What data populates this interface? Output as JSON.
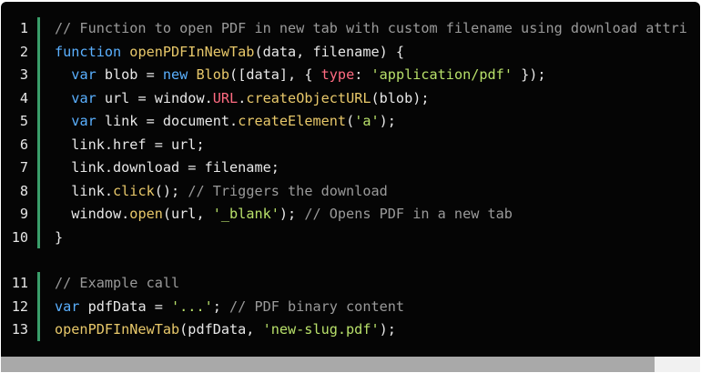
{
  "code_block_1": {
    "lines": [
      {
        "num": "1",
        "tokens": [
          {
            "t": "comment",
            "v": "// Function to open PDF in new tab with custom filename using download attri"
          }
        ]
      },
      {
        "num": "2",
        "tokens": [
          {
            "t": "kw",
            "v": "function "
          },
          {
            "t": "fn",
            "v": "openPDFInNewTab"
          },
          {
            "t": "plain",
            "v": "(data, filename) {"
          }
        ]
      },
      {
        "num": "3",
        "tokens": [
          {
            "t": "plain",
            "v": "  "
          },
          {
            "t": "kw",
            "v": "var "
          },
          {
            "t": "plain",
            "v": "blob = "
          },
          {
            "t": "kw",
            "v": "new "
          },
          {
            "t": "fn",
            "v": "Blob"
          },
          {
            "t": "plain",
            "v": "([data], { "
          },
          {
            "t": "prop",
            "v": "type"
          },
          {
            "t": "plain",
            "v": ": "
          },
          {
            "t": "str",
            "v": "'application/pdf'"
          },
          {
            "t": "plain",
            "v": " });"
          }
        ]
      },
      {
        "num": "4",
        "tokens": [
          {
            "t": "plain",
            "v": "  "
          },
          {
            "t": "kw",
            "v": "var "
          },
          {
            "t": "plain",
            "v": "url = window."
          },
          {
            "t": "prop",
            "v": "URL"
          },
          {
            "t": "plain",
            "v": "."
          },
          {
            "t": "fn",
            "v": "createObjectURL"
          },
          {
            "t": "plain",
            "v": "(blob);"
          }
        ]
      },
      {
        "num": "5",
        "tokens": [
          {
            "t": "plain",
            "v": "  "
          },
          {
            "t": "kw",
            "v": "var "
          },
          {
            "t": "plain",
            "v": "link = document."
          },
          {
            "t": "fn",
            "v": "createElement"
          },
          {
            "t": "plain",
            "v": "("
          },
          {
            "t": "str",
            "v": "'a'"
          },
          {
            "t": "plain",
            "v": ");"
          }
        ]
      },
      {
        "num": "6",
        "tokens": [
          {
            "t": "plain",
            "v": "  link.href = url;"
          }
        ]
      },
      {
        "num": "7",
        "tokens": [
          {
            "t": "plain",
            "v": "  link.download = filename;"
          }
        ]
      },
      {
        "num": "8",
        "tokens": [
          {
            "t": "plain",
            "v": "  link."
          },
          {
            "t": "fn",
            "v": "click"
          },
          {
            "t": "plain",
            "v": "(); "
          },
          {
            "t": "comment",
            "v": "// Triggers the download"
          }
        ]
      },
      {
        "num": "9",
        "tokens": [
          {
            "t": "plain",
            "v": "  window."
          },
          {
            "t": "fn",
            "v": "open"
          },
          {
            "t": "plain",
            "v": "(url, "
          },
          {
            "t": "str",
            "v": "'_blank'"
          },
          {
            "t": "plain",
            "v": "); "
          },
          {
            "t": "comment",
            "v": "// Opens PDF in a new tab"
          }
        ]
      },
      {
        "num": "10",
        "tokens": [
          {
            "t": "plain",
            "v": "}"
          }
        ]
      }
    ]
  },
  "code_block_2": {
    "lines": [
      {
        "num": "11",
        "tokens": [
          {
            "t": "comment",
            "v": "// Example call"
          }
        ]
      },
      {
        "num": "12",
        "tokens": [
          {
            "t": "kw",
            "v": "var "
          },
          {
            "t": "plain",
            "v": "pdfData = "
          },
          {
            "t": "str",
            "v": "'...'"
          },
          {
            "t": "plain",
            "v": "; "
          },
          {
            "t": "comment",
            "v": "// PDF binary content"
          }
        ]
      },
      {
        "num": "13",
        "tokens": [
          {
            "t": "fn",
            "v": "openPDFInNewTab"
          },
          {
            "t": "plain",
            "v": "(pdfData, "
          },
          {
            "t": "str",
            "v": "'new-slug.pdf'"
          },
          {
            "t": "plain",
            "v": ");"
          }
        ]
      }
    ]
  },
  "colors": {
    "background": "#050505",
    "accent_bar": "#3a9e6a",
    "keyword": "#5ab0ff",
    "function": "#e8c86a",
    "string": "#b8e06a",
    "property": "#ff6b81",
    "comment": "#9a9a9a"
  }
}
